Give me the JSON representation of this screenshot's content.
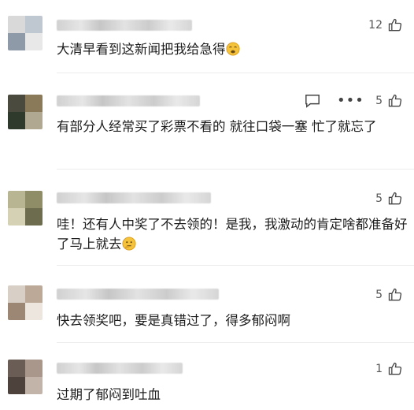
{
  "comments": [
    {
      "text": "大清早看到这新闻把我给急得",
      "emoji": "weary-face",
      "likes": "12",
      "avatar_colors": [
        "#d9d9d9",
        "#bfc7d1",
        "#8f9aa8",
        "#e8e8e8"
      ]
    },
    {
      "text": "有部分人经常买了彩票不看的 就往口袋一塞 忙了就忘了",
      "likes": "5",
      "avatar_colors": [
        "#4a4a3e",
        "#8b7a5a",
        "#2f3a2c",
        "#b0a890"
      ]
    },
    {
      "text": "哇！还有人中奖了不去领的！是我，我激动的肯定啥都准备好了马上就去",
      "emoji": "thinking-face",
      "likes": "5",
      "avatar_colors": [
        "#b7b592",
        "#8f8d68",
        "#d4d1b4",
        "#6e6c4f"
      ]
    },
    {
      "text": "快去领奖吧，要是真错过了，得多郁闷啊",
      "likes": "5",
      "avatar_colors": [
        "#d8cfc6",
        "#bda998",
        "#9c8775",
        "#ece6df"
      ]
    },
    {
      "text": "过期了郁闷到吐血",
      "likes": "1",
      "avatar_colors": [
        "#6a5d55",
        "#a8978a",
        "#4d423c",
        "#c2b4a8"
      ]
    }
  ]
}
